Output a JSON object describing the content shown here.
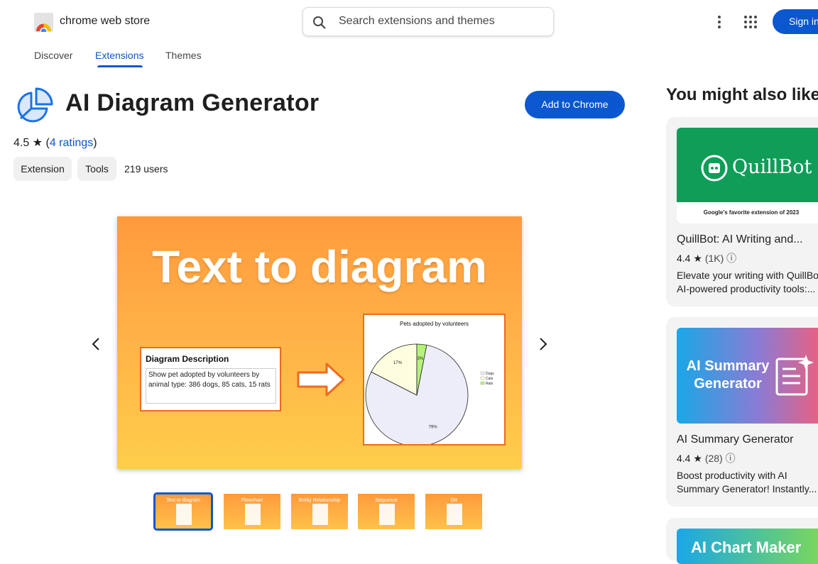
{
  "header": {
    "store_name": "chrome web store",
    "search_placeholder": "Search extensions and themes",
    "signin_label": "Sign in"
  },
  "nav": {
    "discover": "Discover",
    "extensions": "Extensions",
    "themes": "Themes"
  },
  "extension": {
    "title": "AI Diagram Generator",
    "add_label": "Add to Chrome",
    "rating": "4.5",
    "ratings_link": "4 ratings",
    "chips": [
      "Extension",
      "Tools"
    ],
    "users": "219 users"
  },
  "slide": {
    "title": "Text to diagram",
    "desc_title": "Diagram Description",
    "desc_text": "Show pet adopted by volunteers by animal type: 386 dogs, 85 cats, 15 rats",
    "pie_title": "Pets adopted by volunteers",
    "pie": [
      {
        "label": "Dogs",
        "pct": "79%",
        "value": 386,
        "color": "#ededfa"
      },
      {
        "label": "Cats",
        "pct": "17%",
        "value": 85,
        "color": "#fdfde0"
      },
      {
        "label": "Rats",
        "pct": "3%",
        "value": 15,
        "color": "#b6f27a"
      }
    ]
  },
  "thumbnails": [
    "Text to diagram",
    "Flowchart",
    "Entity Relationship",
    "Sequence",
    "Git"
  ],
  "sidebar": {
    "heading": "You might also like...",
    "cards": [
      {
        "name": "QuillBot: AI Writing and...",
        "rating": "4.4",
        "count": "(1K)",
        "desc1": "Elevate your writing with QuillBot",
        "desc2": "AI-powered productivity tools:...",
        "img_text": "QuillBot",
        "img_badge": "Google's favorite extension of 2023"
      },
      {
        "name": "AI Summary Generator",
        "rating": "4.4",
        "count": "(28)",
        "desc1": "Boost productivity with AI",
        "desc2": "Summary Generator! Instantly...",
        "img_line1": "AI Summary",
        "img_line2": "Generator"
      },
      {
        "name": "AI Chart Maker"
      }
    ]
  },
  "colors": {
    "accent": "#0b57d0",
    "slide_border": "#f06a1e"
  }
}
